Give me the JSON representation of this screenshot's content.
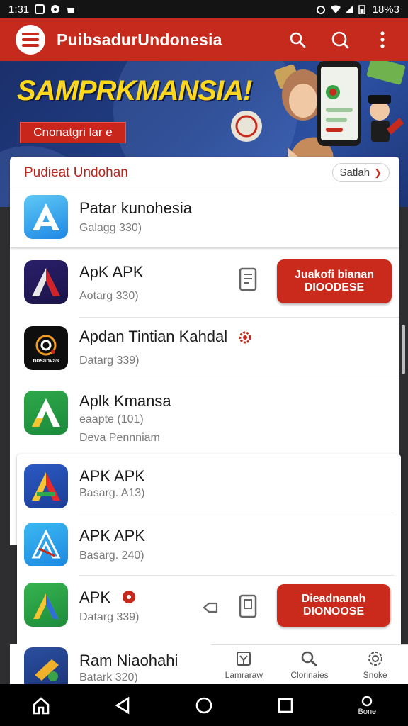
{
  "status_bar": {
    "time": "1:31",
    "battery": "18%3"
  },
  "app_bar": {
    "title": "PuibsadurUndonesia"
  },
  "banner": {
    "headline": "SAMPRKMANSIA!",
    "cta": "Cnonatgri lar e"
  },
  "section": {
    "title": "Pudieat Undohan",
    "see_all": "Satlah"
  },
  "apps": [
    {
      "name": "Patar kunohesia",
      "sub": "Galagg 330)"
    },
    {
      "name": "ApK  APK",
      "sub": "Aotarg 330)",
      "action": "Juakofi bianan DIOODESE"
    },
    {
      "name": "Apdan Tintian Kahdal",
      "sub": "Datarg 339)",
      "icon_caption": "nosanvas"
    },
    {
      "name": "Aplk Kmansa",
      "sub": "eaapte (101)",
      "sub2": "Deva Pennniam"
    },
    {
      "name": "APK  APK",
      "sub": "Basarg. A13)"
    },
    {
      "name": "APK  APK",
      "sub": "Basarg. 240)"
    },
    {
      "name": "APK",
      "sub": "Datarg 339)",
      "action": "Dieadnanah DIONOOSE"
    },
    {
      "name": "Ram Niaohahi",
      "sub": "Batark 320)"
    }
  ],
  "tabs": [
    {
      "label": "Lamraraw",
      "icon": "checkbox-icon"
    },
    {
      "label": "Clorinaies",
      "icon": "search-icon"
    },
    {
      "label": "Snoke",
      "icon": "gear-icon"
    }
  ],
  "nav": {
    "recents_caption": "Bone"
  },
  "colors": {
    "brand_red": "#c62a1c",
    "banner_blue": "#203f86",
    "banner_yellow": "#ffd81c"
  }
}
